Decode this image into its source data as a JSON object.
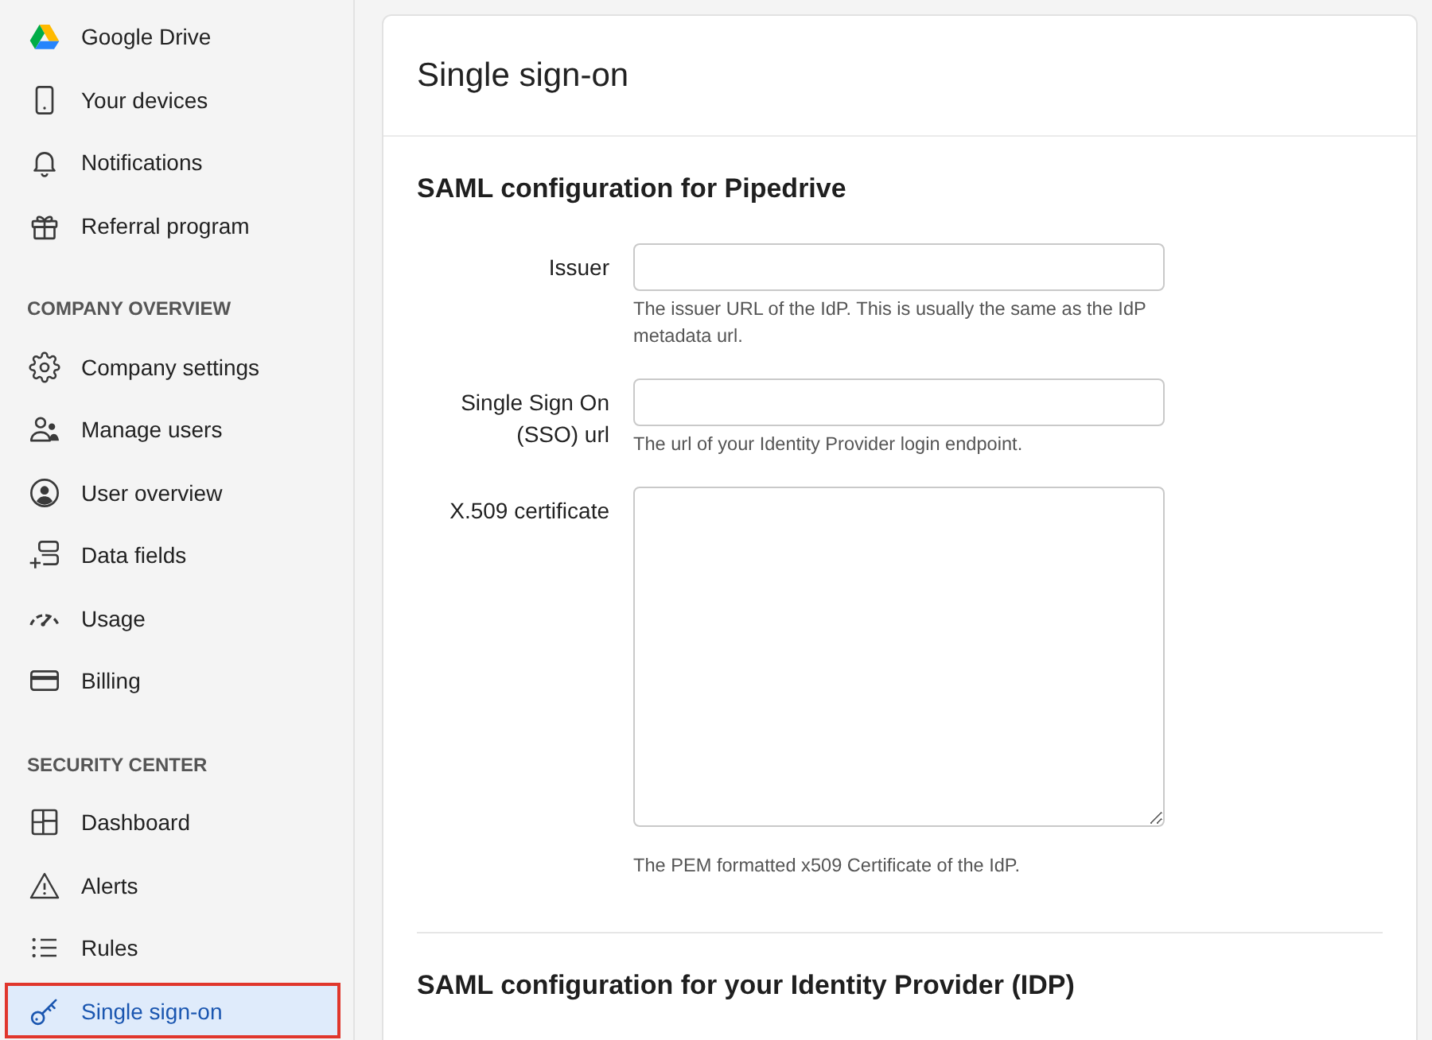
{
  "sidebar": {
    "groups": [
      {
        "items": [
          {
            "label": "Google Drive",
            "selected": false
          },
          {
            "label": "Your devices",
            "selected": false
          },
          {
            "label": "Notifications",
            "selected": false
          },
          {
            "label": "Referral program",
            "selected": false
          }
        ]
      },
      {
        "heading": "COMPANY OVERVIEW",
        "items": [
          {
            "label": "Company settings",
            "selected": false
          },
          {
            "label": "Manage users",
            "selected": false
          },
          {
            "label": "User overview",
            "selected": false
          },
          {
            "label": "Data fields",
            "selected": false
          },
          {
            "label": "Usage",
            "selected": false
          },
          {
            "label": "Billing",
            "selected": false
          }
        ]
      },
      {
        "heading": "SECURITY CENTER",
        "items": [
          {
            "label": "Dashboard",
            "selected": false
          },
          {
            "label": "Alerts",
            "selected": false
          },
          {
            "label": "Rules",
            "selected": false
          },
          {
            "label": "Single sign-on",
            "selected": true
          }
        ]
      }
    ]
  },
  "card": {
    "title": "Single sign-on",
    "sections": [
      {
        "heading": "SAML configuration for Pipedrive",
        "fields": [
          {
            "kind": "input",
            "label": "Issuer",
            "hint": "The issuer URL of the IdP. This is usually the same as the IdP metadata url."
          },
          {
            "kind": "input",
            "label": "Single Sign On (SSO) url",
            "hint": "The url of your Identity Provider login endpoint."
          },
          {
            "kind": "textarea",
            "label": "X.509 certificate",
            "hint": "The PEM formatted x509 Certificate of the IdP."
          }
        ]
      },
      {
        "heading": "SAML configuration for your Identity Provider (IDP)"
      }
    ]
  }
}
